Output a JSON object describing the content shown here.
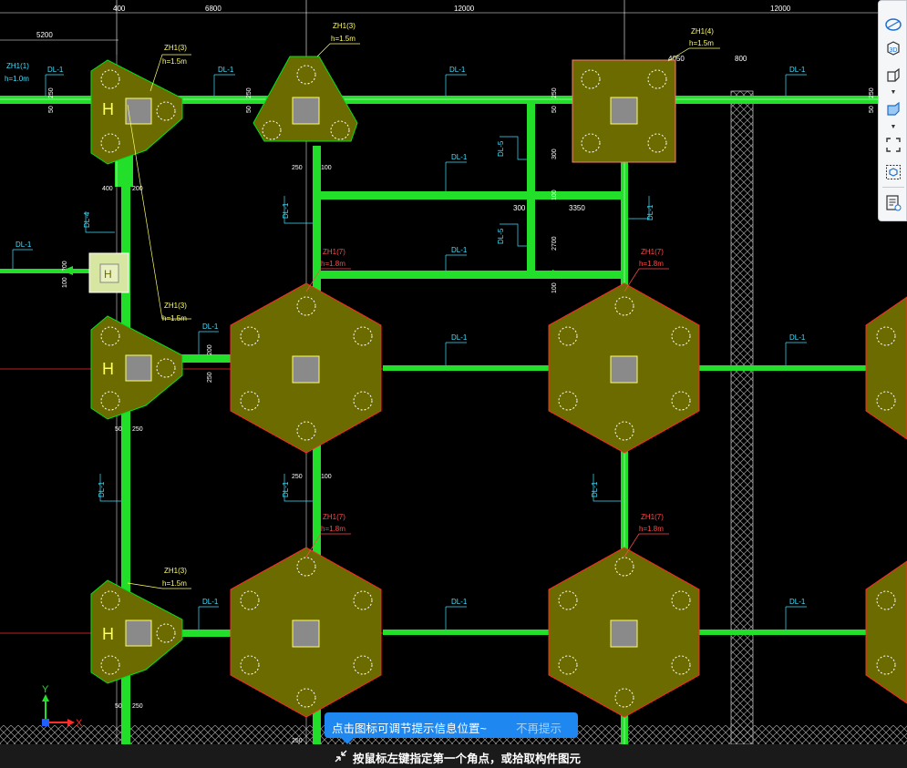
{
  "colors": {
    "background": "#000000",
    "beam": "#22e02a",
    "cap_fill": "#6b6b00",
    "cap_outline_red": "#ff2a2a",
    "cap_outline_green": "#00e020",
    "dim_white": "#ffffff",
    "label_yellow": "#ffff66",
    "label_cyan": "#40e0ff",
    "pile_square": "#8a8a8a",
    "tip_blue": "#1e88f0"
  },
  "dimensions": {
    "top": [
      "400",
      "6800",
      "12000",
      "12000"
    ],
    "labels": [
      "5200",
      "400",
      "200",
      "250",
      "100",
      "300",
      "3350",
      "800",
      "4050",
      "2700",
      "50"
    ]
  },
  "caps": {
    "zh1_3": {
      "name": "ZH1(3)",
      "h": "h=1.5m"
    },
    "zh1_7": {
      "name": "ZH1(7)",
      "h": "h=1.8m"
    },
    "zh1_4": {
      "name": "ZH1(4)",
      "h": "h=1.5m"
    },
    "zh1_1": {
      "name": "ZH1(1)",
      "h": "h=1.0m"
    }
  },
  "beam_labels": {
    "dl1": "DL-1",
    "dl4": "DL-4",
    "dl5": "DL-5"
  },
  "axis": {
    "y": "Y",
    "x": "X"
  },
  "toolbar": {
    "items": [
      {
        "icon": "orbit-icon"
      },
      {
        "icon": "view-3d-icon",
        "text": "3D"
      },
      {
        "icon": "box-view-icon"
      },
      {
        "icon": "solid-box-icon"
      },
      {
        "icon": "fullscreen-icon"
      },
      {
        "icon": "isolate-icon"
      },
      {
        "icon": "properties-list-icon"
      }
    ]
  },
  "tip": {
    "message": "点击图标可调节提示信息位置~",
    "dismiss": "不再提示"
  },
  "status": {
    "prompt": "按鼠标左键指定第一个角点，或拾取构件图元"
  }
}
